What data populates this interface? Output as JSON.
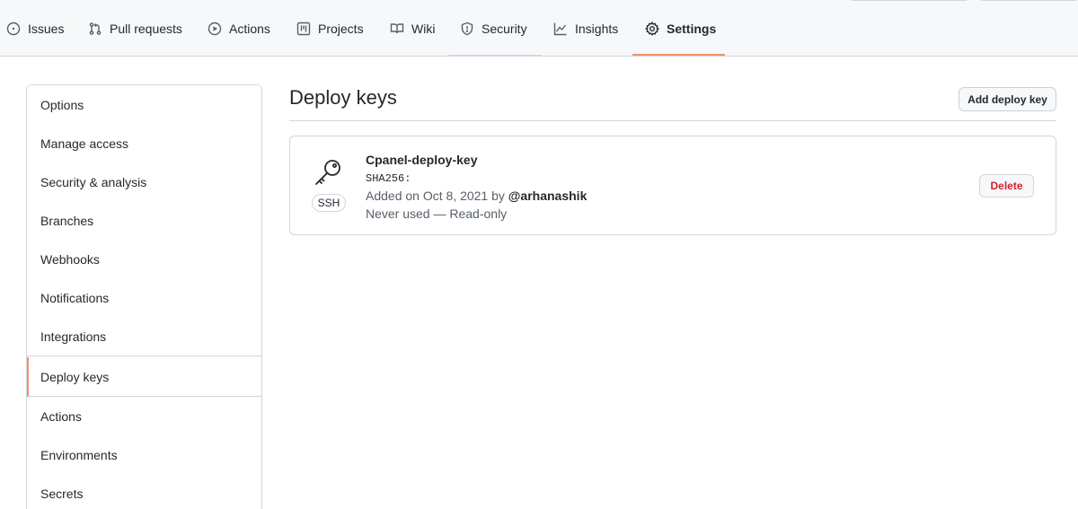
{
  "repo_nav": {
    "tabs": [
      {
        "label": "Issues",
        "icon": "issue-opened-icon"
      },
      {
        "label": "Pull requests",
        "icon": "git-pull-request-icon"
      },
      {
        "label": "Actions",
        "icon": "play-icon"
      },
      {
        "label": "Projects",
        "icon": "table-icon"
      },
      {
        "label": "Wiki",
        "icon": "book-icon"
      },
      {
        "label": "Security",
        "icon": "shield-icon"
      },
      {
        "label": "Insights",
        "icon": "graph-icon"
      },
      {
        "label": "Settings",
        "icon": "gear-icon"
      }
    ],
    "active_tab": "Settings",
    "accent_color": "#fd8c73"
  },
  "sidebar": {
    "items": [
      {
        "label": "Options"
      },
      {
        "label": "Manage access"
      },
      {
        "label": "Security & analysis"
      },
      {
        "label": "Branches"
      },
      {
        "label": "Webhooks"
      },
      {
        "label": "Notifications"
      },
      {
        "label": "Integrations"
      },
      {
        "label": "Deploy keys"
      },
      {
        "label": "Actions"
      },
      {
        "label": "Environments"
      },
      {
        "label": "Secrets"
      }
    ],
    "active_item": "Deploy keys"
  },
  "main": {
    "title": "Deploy keys",
    "add_button_label": "Add deploy key",
    "keys": [
      {
        "name": "Cpanel-deploy-key",
        "fingerprint_prefix": "SHA256:",
        "added_prefix": "Added on Oct 8, 2021 by ",
        "added_by": "@arhanashik",
        "usage": "Never used — Read-only",
        "type_badge": "SSH",
        "delete_label": "Delete",
        "delete_color": "#cf222e"
      }
    ]
  }
}
